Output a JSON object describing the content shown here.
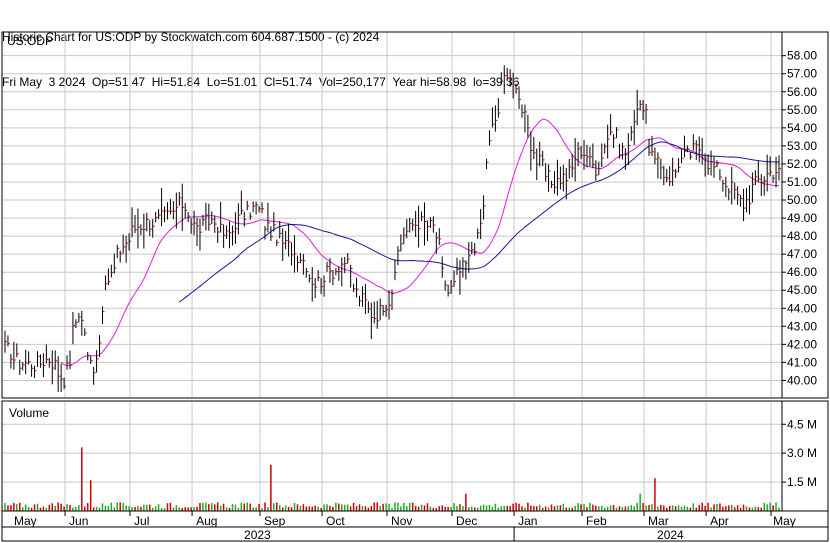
{
  "header": {
    "line1": "Historic Chart for US:ODP by Stockwatch.com 604.687.1500 - (c) 2024",
    "line2": "Fri May  3 2024  Op=51.47  Hi=51.84  Lo=51.01  Cl=51.74  Vol=250,177  Year hi=58.98  lo=39.36"
  },
  "chart_data": {
    "type": "line",
    "symbol_label": "US:ODP",
    "volume_label": "Volume",
    "price_ylim": [
      39.36,
      58.98
    ],
    "price_ticks": [
      "40.00",
      "41.00",
      "42.00",
      "43.00",
      "44.00",
      "45.00",
      "46.00",
      "47.00",
      "48.00",
      "49.00",
      "50.00",
      "51.00",
      "52.00",
      "53.00",
      "54.00",
      "55.00",
      "56.00",
      "57.00",
      "58.00"
    ],
    "volume_ticks": [
      "1.5 M",
      "3.0 M",
      "4.5 M"
    ],
    "volume_tick_values": [
      1.5,
      3.0,
      4.5
    ],
    "months": [
      "May",
      "Jun",
      "Jul",
      "Aug",
      "Sep",
      "Oct",
      "Nov",
      "Dec",
      "Jan",
      "Feb",
      "Mar",
      "Apr",
      "May"
    ],
    "years": [
      "2023",
      "2024"
    ],
    "colors": {
      "price_bar": "#000000",
      "close_tick": "#cc0000",
      "ma_short": "#dd22dd",
      "ma_long": "#1a1a99",
      "volume_up": "#22aa22",
      "volume_down": "#cc0000",
      "grid": "#c8c8c8"
    },
    "close_anchors": [
      {
        "date": "2023-05-03",
        "value": 41.8
      },
      {
        "date": "2023-05-10",
        "value": 41.0
      },
      {
        "date": "2023-05-17",
        "value": 40.9
      },
      {
        "date": "2023-05-24",
        "value": 41.2
      },
      {
        "date": "2023-05-31",
        "value": 40.1
      },
      {
        "date": "2023-06-07",
        "value": 43.8
      },
      {
        "date": "2023-06-12",
        "value": 41.2
      },
      {
        "date": "2023-06-14",
        "value": 40.8
      },
      {
        "date": "2023-06-21",
        "value": 45.6
      },
      {
        "date": "2023-06-28",
        "value": 47.5
      },
      {
        "date": "2023-07-05",
        "value": 48.6
      },
      {
        "date": "2023-07-12",
        "value": 48.8
      },
      {
        "date": "2023-07-19",
        "value": 49.1
      },
      {
        "date": "2023-07-26",
        "value": 49.8
      },
      {
        "date": "2023-08-02",
        "value": 48.4
      },
      {
        "date": "2023-08-09",
        "value": 48.9
      },
      {
        "date": "2023-08-16",
        "value": 48.0
      },
      {
        "date": "2023-08-23",
        "value": 49.1
      },
      {
        "date": "2023-08-30",
        "value": 49.6
      },
      {
        "date": "2023-09-06",
        "value": 48.3
      },
      {
        "date": "2023-09-13",
        "value": 47.5
      },
      {
        "date": "2023-09-20",
        "value": 46.9
      },
      {
        "date": "2023-09-27",
        "value": 45.4
      },
      {
        "date": "2023-10-04",
        "value": 46.0
      },
      {
        "date": "2023-10-11",
        "value": 46.6
      },
      {
        "date": "2023-10-18",
        "value": 44.6
      },
      {
        "date": "2023-10-25",
        "value": 43.6
      },
      {
        "date": "2023-11-01",
        "value": 44.5
      },
      {
        "date": "2023-11-08",
        "value": 48.2
      },
      {
        "date": "2023-11-15",
        "value": 48.8
      },
      {
        "date": "2023-11-22",
        "value": 48.5
      },
      {
        "date": "2023-11-29",
        "value": 44.9
      },
      {
        "date": "2023-12-06",
        "value": 46.2
      },
      {
        "date": "2023-12-13",
        "value": 47.8
      },
      {
        "date": "2023-12-20",
        "value": 54.0
      },
      {
        "date": "2023-12-27",
        "value": 57.2
      },
      {
        "date": "2024-01-03",
        "value": 55.2
      },
      {
        "date": "2024-01-10",
        "value": 52.2
      },
      {
        "date": "2024-01-17",
        "value": 51.0
      },
      {
        "date": "2024-01-24",
        "value": 51.3
      },
      {
        "date": "2024-01-31",
        "value": 52.8
      },
      {
        "date": "2024-02-07",
        "value": 51.8
      },
      {
        "date": "2024-02-14",
        "value": 53.8
      },
      {
        "date": "2024-02-21",
        "value": 52.6
      },
      {
        "date": "2024-02-28",
        "value": 55.6
      },
      {
        "date": "2024-03-06",
        "value": 52.0
      },
      {
        "date": "2024-03-13",
        "value": 51.3
      },
      {
        "date": "2024-03-20",
        "value": 52.4
      },
      {
        "date": "2024-03-27",
        "value": 52.9
      },
      {
        "date": "2024-04-03",
        "value": 51.8
      },
      {
        "date": "2024-04-10",
        "value": 50.8
      },
      {
        "date": "2024-04-17",
        "value": 49.8
      },
      {
        "date": "2024-04-24",
        "value": 51.1
      },
      {
        "date": "2024-05-03",
        "value": 51.74
      }
    ],
    "volume_spikes": [
      {
        "date": "2023-06-08",
        "value": 3.3
      },
      {
        "date": "2023-06-13",
        "value": 1.6
      },
      {
        "date": "2023-09-06",
        "value": 2.4
      },
      {
        "date": "2023-12-07",
        "value": 0.9
      },
      {
        "date": "2024-02-28",
        "value": 0.9
      },
      {
        "date": "2024-03-06",
        "value": 1.7
      }
    ]
  }
}
